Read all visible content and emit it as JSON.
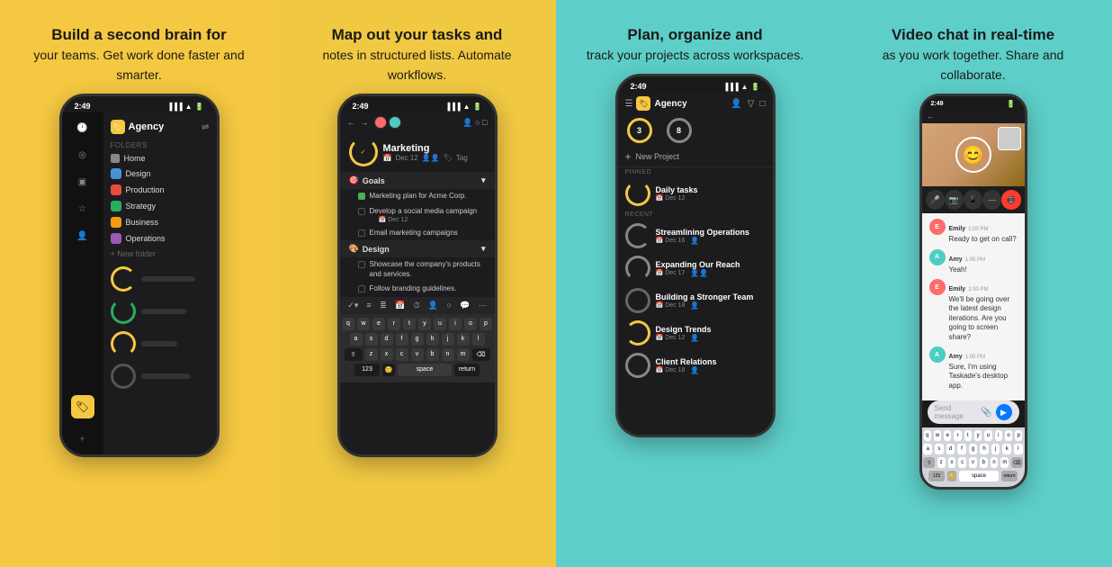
{
  "panels": [
    {
      "id": "panel1",
      "bg": "#F5C842",
      "heading_bold": "Build a second brain for",
      "heading_normal": "your teams. Get work done faster and smarter.",
      "phone": {
        "status_time": "2:49",
        "workspace": "Agency",
        "folders": [
          "Home",
          "Design",
          "Production",
          "Strategy",
          "Business",
          "Operations"
        ],
        "folder_colors": [
          "#ccc",
          "#4A90D9",
          "#E74C3C",
          "#27AE60",
          "#F39C12",
          "#9B59B6"
        ],
        "new_folder": "+ New folder"
      }
    },
    {
      "id": "panel2",
      "bg": "#F0C842",
      "heading_bold": "Map out your tasks and",
      "heading_normal": "notes in structured lists. Automate workflows.",
      "phone": {
        "status_time": "2:49",
        "task_title": "Marketing",
        "task_date": "Dec 12",
        "task_tag": "Tag",
        "sections": [
          {
            "name": "Goals",
            "emoji": "🎯",
            "items": [
              "Marketing plan for Acme Corp.",
              "Develop a social media campaign",
              "Email marketing campaigns"
            ],
            "dates": [
              "",
              "Dec 12",
              ""
            ]
          },
          {
            "name": "Design",
            "emoji": "🎨",
            "items": [
              "Showcase the company's products and services.",
              "Follow branding guidelines."
            ],
            "dates": [
              "",
              ""
            ]
          }
        ],
        "keyboard_rows": [
          [
            "q",
            "w",
            "e",
            "r",
            "t",
            "y",
            "u",
            "i",
            "o",
            "p"
          ],
          [
            "a",
            "s",
            "d",
            "f",
            "g",
            "h",
            "j",
            "k",
            "l"
          ],
          [
            "⇧",
            "z",
            "x",
            "c",
            "v",
            "b",
            "n",
            "m",
            "⌫"
          ],
          [
            "123",
            "😊",
            "space",
            "return"
          ]
        ]
      }
    },
    {
      "id": "panel3",
      "bg": "#5ECEC8",
      "heading_bold": "Plan, organize and",
      "heading_normal": "track your projects across workspaces.",
      "phone": {
        "status_time": "2:49",
        "workspace": "Agency",
        "counts": [
          3,
          8
        ],
        "new_project": "New Project",
        "pinned_label": "PINNED",
        "pinned": [
          {
            "name": "Daily tasks",
            "date": "Dec 12"
          }
        ],
        "recent_label": "RECENT",
        "recent": [
          {
            "name": "Streamlining Operations",
            "date": "Dec 16"
          },
          {
            "name": "Expanding Our Reach",
            "date": "Dec 17"
          },
          {
            "name": "Building a Stronger Team",
            "date": "Dec 18"
          },
          {
            "name": "Design Trends",
            "date": "Dec 12"
          },
          {
            "name": "Client Relations",
            "date": "Dec 18"
          }
        ]
      }
    },
    {
      "id": "panel4",
      "bg": "#5ECEC8",
      "heading_bold": "Video chat in real-time",
      "heading_normal": "as you work together. Share and collaborate.",
      "chat": {
        "status_time": "2:49",
        "messages": [
          {
            "sender": "Emily",
            "time": "1:00 PM",
            "text": "Ready to get on call?",
            "color": "#FF6B6B"
          },
          {
            "sender": "Amy",
            "time": "1:05 PM",
            "text": "Yeah!",
            "color": "#4ECDC4"
          },
          {
            "sender": "Emily",
            "time": "1:00 PM",
            "text": "We'll be going over the latest design iterations. Are you going to screen share?",
            "color": "#FF6B6B"
          },
          {
            "sender": "Amy",
            "time": "1:05 PM",
            "text": "Sure, I'm using Taskade's desktop app.",
            "color": "#4ECDC4"
          }
        ],
        "input_placeholder": "Send message",
        "keyboard_rows": [
          [
            "q",
            "w",
            "e",
            "r",
            "t",
            "y",
            "u",
            "i",
            "o",
            "p"
          ],
          [
            "a",
            "s",
            "d",
            "f",
            "g",
            "h",
            "j",
            "k",
            "l"
          ],
          [
            "⇧",
            "z",
            "x",
            "c",
            "v",
            "b",
            "n",
            "m",
            "⌫"
          ],
          [
            "123",
            "😊",
            "space",
            "return"
          ]
        ]
      }
    }
  ]
}
